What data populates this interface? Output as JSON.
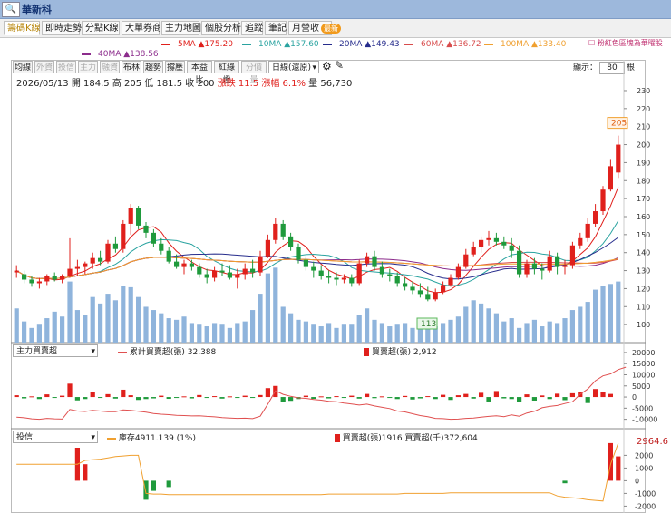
{
  "app": {
    "zoom_label": "🔍+",
    "title": "華新科"
  },
  "tabs": [
    {
      "label": "籌碼K線",
      "active": true
    },
    {
      "label": "即時走勢"
    },
    {
      "label": "分點K線"
    },
    {
      "label": "大單券商"
    },
    {
      "label": "主力地圖"
    },
    {
      "label": "個股分析"
    },
    {
      "label": "追蹤"
    },
    {
      "label": "筆記"
    },
    {
      "label": "月營收",
      "badge": "最新"
    }
  ],
  "ma_legend": [
    {
      "label": "5MA ▲175.20",
      "color": "#e0201c"
    },
    {
      "label": "10MA ▲157.60",
      "color": "#2aa3a0"
    },
    {
      "label": "20MA ▲149.43",
      "color": "#262c8c"
    },
    {
      "label": "60MA ▲136.72",
      "color": "#d84c4c"
    },
    {
      "label": "100MA ▲133.40",
      "color": "#f0a030"
    },
    {
      "label": "40MA ▲138.56",
      "color": "#8c2c8c"
    }
  ],
  "hint": "☐ 粉紅色區塊為華曜股",
  "toolbar": {
    "buttons": [
      {
        "label": "均線",
        "enabled": true
      },
      {
        "label": "外資",
        "enabled": false
      },
      {
        "label": "投信",
        "enabled": false
      },
      {
        "label": "主力",
        "enabled": false
      },
      {
        "label": "融資",
        "enabled": false
      },
      {
        "label": "布林",
        "enabled": true
      },
      {
        "label": "趨勢",
        "enabled": true
      },
      {
        "label": "撐壓",
        "enabled": true
      },
      {
        "label": "本益比",
        "enabled": true
      },
      {
        "label": "紅綠燈",
        "enabled": true
      },
      {
        "label": "分價量",
        "enabled": false
      }
    ],
    "period_select": "日線(還原)",
    "display_label": "顯示：",
    "display_count": "80",
    "display_unit": "根"
  },
  "quote": {
    "date": "2026/05/13",
    "open": "開 184.5",
    "high": "高 205",
    "low": "低 181.5",
    "close": "收 200",
    "change": "漲跌 11.5",
    "pct": "漲幅 6.1%",
    "volume": "量 56,730"
  },
  "panel2": {
    "select": "主力買賣超",
    "legend_line": "累計買賣超(張) 32,388",
    "legend_bar": "買賣超(張) 2,912"
  },
  "panel3": {
    "select": "投信",
    "legend_line": "庫存4911.139 (1%)",
    "legend_bar": "買賣超(張)1916 買賣超(千)372,604",
    "value_box": "2964.6"
  },
  "chart_data": [
    {
      "type": "candlestick",
      "title": "華新科",
      "ylim": [
        90,
        232
      ],
      "y_ticks": [
        100,
        110,
        120,
        130,
        140,
        150,
        160,
        170,
        180,
        190,
        200,
        210,
        220,
        230
      ],
      "high_label": "205",
      "low_label": "113",
      "candles": [
        [
          129,
          133,
          126,
          130
        ],
        [
          128,
          130,
          123,
          125
        ],
        [
          125,
          127,
          121,
          123
        ],
        [
          123,
          126,
          120,
          124
        ],
        [
          124,
          128,
          122,
          127
        ],
        [
          127,
          129,
          124,
          125
        ],
        [
          125,
          128,
          123,
          127
        ],
        [
          127,
          148,
          126,
          131
        ],
        [
          131,
          136,
          127,
          132
        ],
        [
          132,
          135,
          128,
          134
        ],
        [
          134,
          140,
          131,
          137
        ],
        [
          137,
          141,
          133,
          135
        ],
        [
          135,
          147,
          134,
          145
        ],
        [
          145,
          149,
          140,
          142
        ],
        [
          142,
          158,
          140,
          156
        ],
        [
          156,
          167,
          150,
          165
        ],
        [
          165,
          166,
          153,
          155
        ],
        [
          155,
          157,
          148,
          151
        ],
        [
          151,
          153,
          143,
          145
        ],
        [
          145,
          148,
          139,
          141
        ],
        [
          141,
          143,
          134,
          135
        ],
        [
          135,
          139,
          131,
          132
        ],
        [
          132,
          136,
          128,
          134
        ],
        [
          134,
          136,
          130,
          132
        ],
        [
          132,
          134,
          126,
          128
        ],
        [
          128,
          131,
          123,
          126
        ],
        [
          126,
          132,
          124,
          130
        ],
        [
          130,
          134,
          127,
          129
        ],
        [
          129,
          133,
          125,
          126
        ],
        [
          126,
          131,
          120,
          128
        ],
        [
          128,
          134,
          125,
          131
        ],
        [
          131,
          136,
          126,
          129
        ],
        [
          129,
          141,
          127,
          138
        ],
        [
          138,
          150,
          137,
          147
        ],
        [
          147,
          159,
          145,
          156
        ],
        [
          156,
          158,
          147,
          149
        ],
        [
          149,
          151,
          141,
          143
        ],
        [
          143,
          145,
          134,
          136
        ],
        [
          136,
          138,
          130,
          132
        ],
        [
          132,
          135,
          126,
          130
        ],
        [
          130,
          133,
          125,
          127
        ],
        [
          127,
          130,
          123,
          126
        ],
        [
          126,
          129,
          122,
          125
        ],
        [
          125,
          128,
          123,
          126
        ],
        [
          126,
          128,
          121,
          123
        ],
        [
          123,
          136,
          122,
          134
        ],
        [
          134,
          140,
          132,
          138
        ],
        [
          138,
          141,
          130,
          132
        ],
        [
          132,
          135,
          126,
          128
        ],
        [
          128,
          131,
          124,
          127
        ],
        [
          127,
          129,
          121,
          123
        ],
        [
          123,
          126,
          119,
          121
        ],
        [
          121,
          124,
          117,
          119
        ],
        [
          119,
          123,
          115,
          117
        ],
        [
          117,
          121,
          113,
          114
        ],
        [
          114,
          120,
          113,
          118
        ],
        [
          118,
          124,
          117,
          122
        ],
        [
          122,
          128,
          121,
          126
        ],
        [
          126,
          134,
          125,
          132
        ],
        [
          132,
          142,
          131,
          139
        ],
        [
          139,
          146,
          138,
          143
        ],
        [
          143,
          149,
          140,
          147
        ],
        [
          147,
          152,
          144,
          148
        ],
        [
          148,
          151,
          144,
          146
        ],
        [
          146,
          149,
          142,
          144
        ],
        [
          144,
          148,
          137,
          141
        ],
        [
          141,
          144,
          126,
          128
        ],
        [
          128,
          136,
          126,
          134
        ],
        [
          134,
          137,
          128,
          131
        ],
        [
          131,
          134,
          125,
          130
        ],
        [
          130,
          141,
          129,
          138
        ],
        [
          138,
          140,
          128,
          132
        ],
        [
          132,
          136,
          128,
          133
        ],
        [
          133,
          146,
          131,
          144
        ],
        [
          144,
          151,
          142,
          148
        ],
        [
          148,
          159,
          146,
          156
        ],
        [
          156,
          167,
          154,
          163
        ],
        [
          163,
          177,
          161,
          175
        ],
        [
          175,
          192,
          174,
          188
        ],
        [
          184.5,
          205,
          181.5,
          200
        ]
      ],
      "volume": [
        42,
        26,
        18,
        22,
        30,
        38,
        32,
        75,
        40,
        34,
        56,
        48,
        60,
        52,
        70,
        68,
        56,
        44,
        40,
        36,
        30,
        28,
        32,
        24,
        22,
        20,
        24,
        22,
        18,
        24,
        26,
        40,
        60,
        85,
        92,
        44,
        36,
        28,
        26,
        22,
        20,
        24,
        18,
        22,
        22,
        34,
        42,
        28,
        24,
        20,
        22,
        24,
        18,
        22,
        26,
        20,
        24,
        28,
        32,
        44,
        52,
        48,
        42,
        36,
        26,
        30,
        18,
        24,
        28,
        20,
        26,
        24,
        30,
        40,
        44,
        50,
        65,
        70,
        72,
        75
      ],
      "volume_scale_ref": {
        "value": 100,
        "label_ticks": [
          100
        ]
      }
    },
    {
      "type": "bar+line",
      "title": "主力買賣超",
      "ylim": [
        -13000,
        22000
      ],
      "y_ticks": [
        -10000,
        -5000,
        0,
        5000,
        10000,
        15000,
        20000
      ],
      "bars": [
        800,
        -600,
        300,
        -900,
        1200,
        -400,
        600,
        6000,
        -1500,
        -900,
        2400,
        -300,
        1300,
        -700,
        3300,
        800,
        -1300,
        -900,
        -600,
        600,
        -800,
        -400,
        300,
        -600,
        900,
        -200,
        400,
        -700,
        300,
        -400,
        600,
        -300,
        900,
        4000,
        5000,
        -2100,
        -1700,
        -900,
        600,
        -800,
        300,
        -600,
        400,
        -300,
        600,
        -700,
        1400,
        -500,
        300,
        -400,
        -900,
        500,
        -1100,
        -600,
        400,
        -900,
        1000,
        -1300,
        800,
        1400,
        -700,
        1900,
        -2000,
        2700,
        -600,
        -900,
        -2400,
        1200,
        -1600,
        700,
        -900,
        1500,
        -1400,
        1700,
        2300,
        -2700,
        3600,
        2100,
        1400
      ],
      "cumulative": [
        -9000,
        -9300,
        -9800,
        -10000,
        -9600,
        -9800,
        -9900,
        -5600,
        -6300,
        -6500,
        -6000,
        -6300,
        -6600,
        -6600,
        -5800,
        -6000,
        -6400,
        -6800,
        -7400,
        -7700,
        -7900,
        -8200,
        -8300,
        -8500,
        -8400,
        -8700,
        -8900,
        -9200,
        -9400,
        -9600,
        -9500,
        -9700,
        -8600,
        -3200,
        2800,
        1200,
        300,
        -400,
        -600,
        -1100,
        -1400,
        -1900,
        -2100,
        -2700,
        -3100,
        -3600,
        -3200,
        -4000,
        -4600,
        -5200,
        -6300,
        -6700,
        -7500,
        -8300,
        -8800,
        -9600,
        -9700,
        -10000,
        -9900,
        -9600,
        -9400,
        -9000,
        -8700,
        -8400,
        -8800,
        -8000,
        -8600,
        -7200,
        -6400,
        -4800,
        -4200,
        -3800,
        -2900,
        -2100,
        1200,
        3600,
        7300,
        9500,
        10400,
        12300,
        13400
      ]
    },
    {
      "type": "bar+line",
      "title": "投信",
      "ylim": [
        -2400,
        3600
      ],
      "y_ticks": [
        -2000,
        -1000,
        0,
        1000,
        2000
      ],
      "bars": [
        0,
        0,
        0,
        0,
        0,
        0,
        0,
        0,
        2600,
        1300,
        0,
        0,
        0,
        0,
        0,
        0,
        0,
        -1500,
        -800,
        0,
        -500,
        0,
        0,
        0,
        0,
        0,
        0,
        0,
        0,
        0,
        0,
        0,
        0,
        0,
        0,
        0,
        0,
        0,
        0,
        0,
        0,
        0,
        0,
        0,
        0,
        0,
        0,
        0,
        0,
        0,
        0,
        0,
        0,
        0,
        0,
        0,
        0,
        0,
        0,
        0,
        0,
        0,
        0,
        0,
        0,
        0,
        0,
        0,
        0,
        0,
        0,
        0,
        -200,
        0,
        0,
        0,
        0,
        0,
        2964,
        1916
      ],
      "cumulative": [
        1300,
        1300,
        1300,
        1300,
        1300,
        1300,
        1300,
        1300,
        1300,
        1600,
        1650,
        1700,
        1800,
        1900,
        1950,
        2000,
        2000,
        -1000,
        -1050,
        -1050,
        -1100,
        -1100,
        -1100,
        -1100,
        -1100,
        -1100,
        -1100,
        -1100,
        -1100,
        -1100,
        -1100,
        -1100,
        -1100,
        -1100,
        -1100,
        -1100,
        -1100,
        -1100,
        -1100,
        -1100,
        -1100,
        -1050,
        -1050,
        -1050,
        -1050,
        -1050,
        -1050,
        -1050,
        -1050,
        -1050,
        -1050,
        -1000,
        -1000,
        -1000,
        -1000,
        -1000,
        -1000,
        -950,
        -950,
        -950,
        -950,
        -950,
        -950,
        -950,
        -950,
        -950,
        -950,
        -950,
        -950,
        -950,
        -950,
        -1200,
        -1300,
        -1350,
        -1400,
        -1500,
        -1550,
        -1600,
        1300,
        2964
      ]
    }
  ]
}
